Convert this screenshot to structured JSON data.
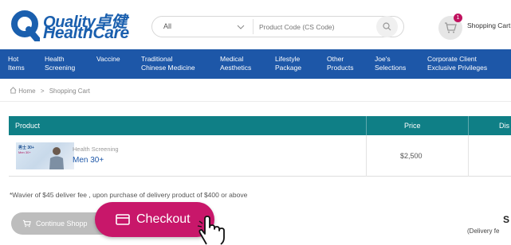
{
  "brand": {
    "name_line1": "Quality卓健",
    "name_line2": "HealthCare",
    "color": "#1a5fae"
  },
  "search": {
    "category_value": "All",
    "placeholder": "Product Code (CS Code)"
  },
  "cart": {
    "label": "Shopping Cart",
    "badge_count": "1",
    "badge_color": "#c0125f"
  },
  "nav": {
    "background": "#1d57a8",
    "items": [
      {
        "line1": "Hot",
        "line2": "Items"
      },
      {
        "line1": "Health",
        "line2": "Screening"
      },
      {
        "line1": "Vaccine",
        "line2": ""
      },
      {
        "line1": "Traditional",
        "line2": "Chinese Medicine"
      },
      {
        "line1": "Medical",
        "line2": "Aesthetics"
      },
      {
        "line1": "Lifestyle",
        "line2": "Package"
      },
      {
        "line1": "Other",
        "line2": "Products"
      },
      {
        "line1": "Joe's",
        "line2": "Selections"
      },
      {
        "line1": "Corporate Client",
        "line2": "Exclusive Privileges"
      }
    ]
  },
  "breadcrumb": {
    "home": "Home",
    "separator": ">",
    "current": "Shopping Cart"
  },
  "table": {
    "header_color": "#0f7f86",
    "columns": [
      "Product",
      "Price",
      "Dis"
    ],
    "rows": [
      {
        "category": "Health Screening",
        "name": "Men 30+",
        "price": "$2,500",
        "thumb_text1": "男士 30+",
        "thumb_text2": "Men 30+"
      }
    ]
  },
  "note": "*Wavier of $45 deliver fee , upon purchase of delivery product of $400 or above",
  "actions": {
    "continue_label": "Continue Shopp",
    "checkout_label": "Checkout",
    "checkout_color": "#c8176a"
  },
  "summary": {
    "title_fragment": "S",
    "sub_fragment": "(Delivery fe"
  }
}
